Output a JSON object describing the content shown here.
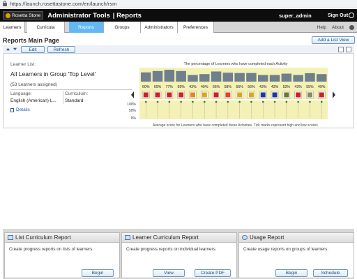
{
  "browser": {
    "url": "https://launch.rosettastone.com/en/launch/rsm"
  },
  "app": {
    "logo": "Rosetta Stone",
    "title": "Administrator Tools",
    "section": "| Reports",
    "user": "super_admin",
    "sign_out": "Sign Out"
  },
  "nav": {
    "tabs": [
      {
        "label": "Learners",
        "active": false
      },
      {
        "label": "Curricula",
        "active": false
      },
      {
        "label": "Reports",
        "active": true
      },
      {
        "label": "Groups",
        "active": false
      },
      {
        "label": "Administrators",
        "active": false
      },
      {
        "label": "Preferences",
        "active": false
      }
    ],
    "help": "Help",
    "about": "About"
  },
  "page": {
    "title": "Reports Main Page",
    "add_list_view": "Add a List View"
  },
  "toolbar": {
    "edit": "Edit",
    "refresh": "Refresh"
  },
  "learner_list": {
    "label": "Learner List:",
    "name": "All Learners in Group 'Top Level'",
    "count": "(53 Learners assigned)",
    "language_label": "Language:",
    "language_value": "English (American) L...",
    "curriculum_label": "Curriculum:",
    "curriculum_value": "Standard",
    "details": "Details"
  },
  "chart_data": {
    "type": "bar",
    "title": "The percentage of Learners who have completed each Activity",
    "footnote": "Average score for Learners who have completed these Activities. Tick marks represent high and low scores.",
    "percent_labels": [
      "60%",
      "69%",
      "77%",
      "69%",
      "43%",
      "49%",
      "66%",
      "58%",
      "56%",
      "56%",
      "43%",
      "43%",
      "52%",
      "43%",
      "55%",
      "49%"
    ],
    "values": [
      60,
      69,
      77,
      69,
      43,
      49,
      66,
      58,
      56,
      56,
      43,
      43,
      52,
      43,
      55,
      49
    ],
    "score_axis_labels": [
      "100%",
      "50%",
      "0%"
    ],
    "activity_icon_colors": [
      "#cc2222",
      "#cc2222",
      "#cc2222",
      "#cc2222",
      "#e08a1a",
      "#d8a81a",
      "#cc2222",
      "#d84a1a",
      "#d8a81a",
      "#d8a81a",
      "#1a3a9a",
      "#1a3a9a",
      "#6a7a2a",
      "#cc2222",
      "#8a8a5a",
      "#cc2222"
    ],
    "ylim": [
      0,
      100
    ]
  },
  "cards": [
    {
      "title": "List Curriculum Report",
      "desc": "Create progress reports on lists of learners.",
      "buttons": [
        "Begin"
      ]
    },
    {
      "title": "Learner Curriculum Report",
      "desc": "Create progress reports on individual learners.",
      "buttons": [
        "View",
        "Create PDF"
      ]
    },
    {
      "title": "Usage Report",
      "desc": "Create usage reports on groups of learners.",
      "buttons": [
        "Begin",
        "Schedule"
      ]
    }
  ]
}
